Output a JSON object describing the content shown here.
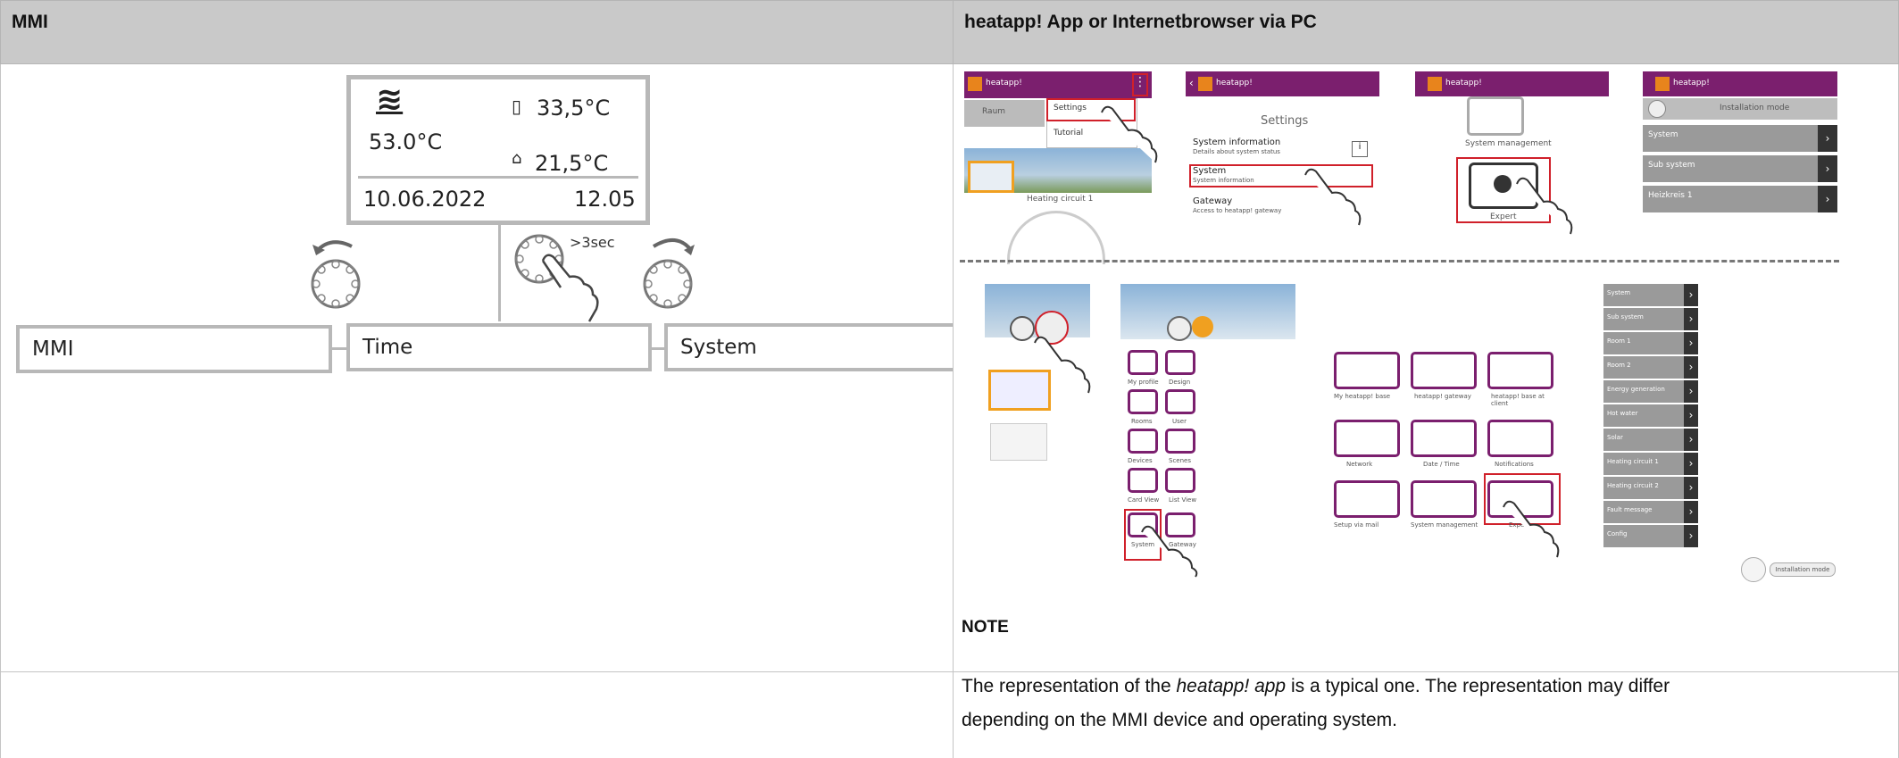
{
  "headers": {
    "left": "MMI",
    "right": "heatapp! App or Internetbrowser via PC"
  },
  "mmi_display": {
    "heat_symbol": "≋",
    "main_temp": "53.0°C",
    "outdoor_icon_value": "33,5°C",
    "indoor_value": "21,5°C",
    "date": "10.06.2022",
    "time": "12.05"
  },
  "mmi_menu": {
    "left": "MMI",
    "middle": "Time",
    "right": "System",
    "press_label": ">3sec"
  },
  "app_screens": {
    "screen1": {
      "brand": "heatapp!",
      "menu_item1": "Settings",
      "menu_item2": "Tutorial",
      "tab": "Raum",
      "caption": "Heating circuit 1"
    },
    "screen2": {
      "brand": "heatapp!",
      "title": "Settings",
      "item1": "System information",
      "item1_sub": "Details about system status",
      "item2": "System",
      "item2_sub": "System information",
      "item3": "Gateway",
      "item3_sub": "Access to heatapp! gateway"
    },
    "screen3": {
      "brand": "heatapp!",
      "label1": "System management",
      "label2": "Expert"
    },
    "screen4": {
      "brand": "heatapp!",
      "title": "Installation mode",
      "rows": [
        "System",
        "Sub system",
        "Heizkreis 1"
      ]
    }
  },
  "bottom_screens": {
    "icons_left": [
      "My profile",
      "Design",
      "Rooms",
      "User",
      "Devices",
      "Scenes",
      "Card View",
      "List View",
      "System",
      "Gateway"
    ],
    "icons_mid": [
      "My heatapp! base",
      "heatapp! gateway",
      "heatapp! base at client",
      "Network",
      "Date / Time",
      "Notifications",
      "Setup via mail",
      "System management",
      "Expert"
    ],
    "list_rows": [
      "System",
      "Sub system",
      "Room 1",
      "Room 2",
      "Energy generation",
      "Hot water",
      "Solar",
      "Heating circuit 1",
      "Heating circuit 2",
      "Fault message",
      "Config"
    ],
    "back_label": "Installation mode"
  },
  "note_title": "NOTE",
  "note_text_pre": "The representation of the ",
  "note_text_em": "heatapp! app",
  "note_text_post": " is a typical one. The representation may differ",
  "note_text_line2": "depending on the MMI device and operating system.",
  "colors": {
    "header_bg": "#c9c9c9",
    "brand": "#7b1f6e",
    "highlight": "#d0202a"
  }
}
